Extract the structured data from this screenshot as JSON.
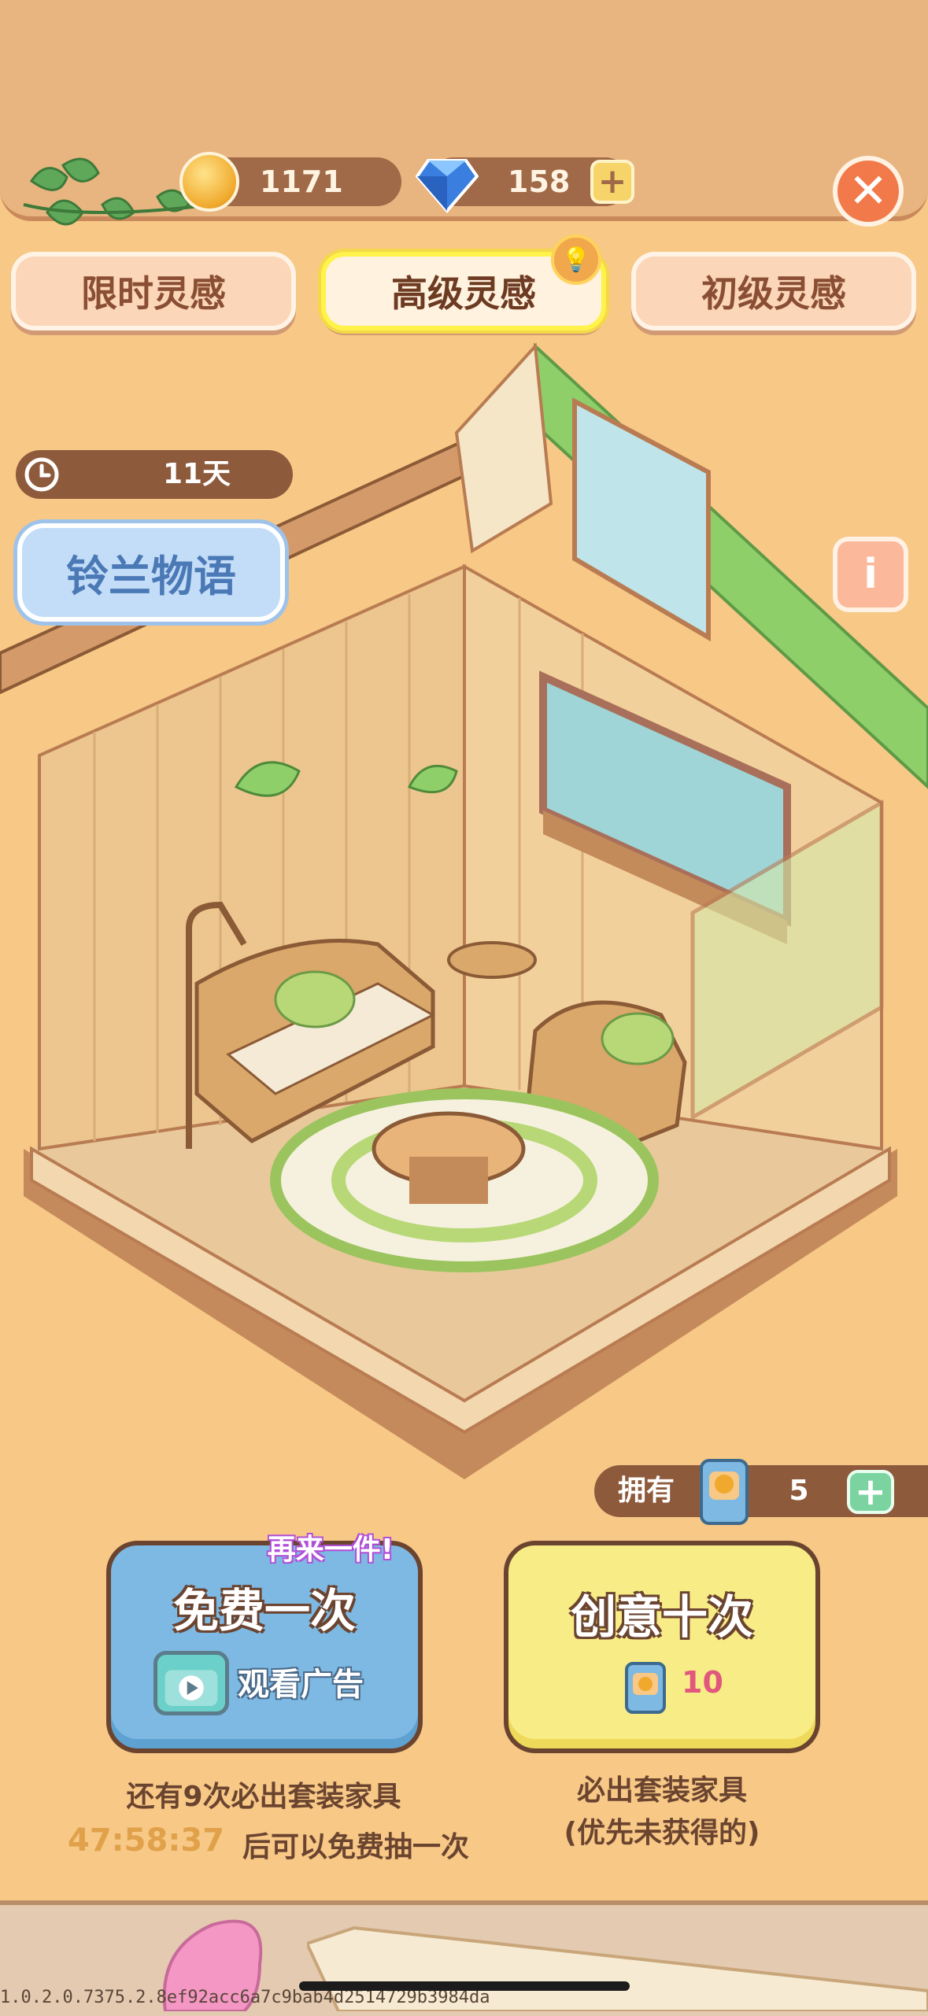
{
  "header": {
    "coins": "1171",
    "gems": "158",
    "add_symbol": "+",
    "close_symbol": "✕"
  },
  "tabs": [
    {
      "label": "限时灵感",
      "selected": false
    },
    {
      "label": "高级灵感",
      "selected": true
    },
    {
      "label": "初级灵感",
      "selected": false
    }
  ],
  "timer": {
    "remaining": "11天"
  },
  "theme": {
    "name": "铃兰物语"
  },
  "info_symbol": "i",
  "owned": {
    "label": "拥有",
    "count": "5",
    "add_symbol": "+"
  },
  "free_draw": {
    "badge": "再来一件!",
    "title": "免费一次",
    "ad_label": "观看广告"
  },
  "ten_draw": {
    "title": "创意十次",
    "cost": "10"
  },
  "captions": {
    "guarantee_count": "还有9次必出套装家具",
    "countdown": "47:58:37",
    "free_after": "后可以免费抽一次",
    "ten_line1": "必出套装家具",
    "ten_line2": "(优先未获得的)"
  },
  "version": "1.0.2.0.7375.2.8ef92acc6a7c9bab4d2514729b3984da",
  "colors": {
    "background": "#f7c886",
    "tab_bg": "#fbd6b8",
    "selected_tab_border": "#f4d84a",
    "free_button": "#7db9e3",
    "ten_button": "#f7ec86",
    "countdown": "#e0a14a"
  }
}
